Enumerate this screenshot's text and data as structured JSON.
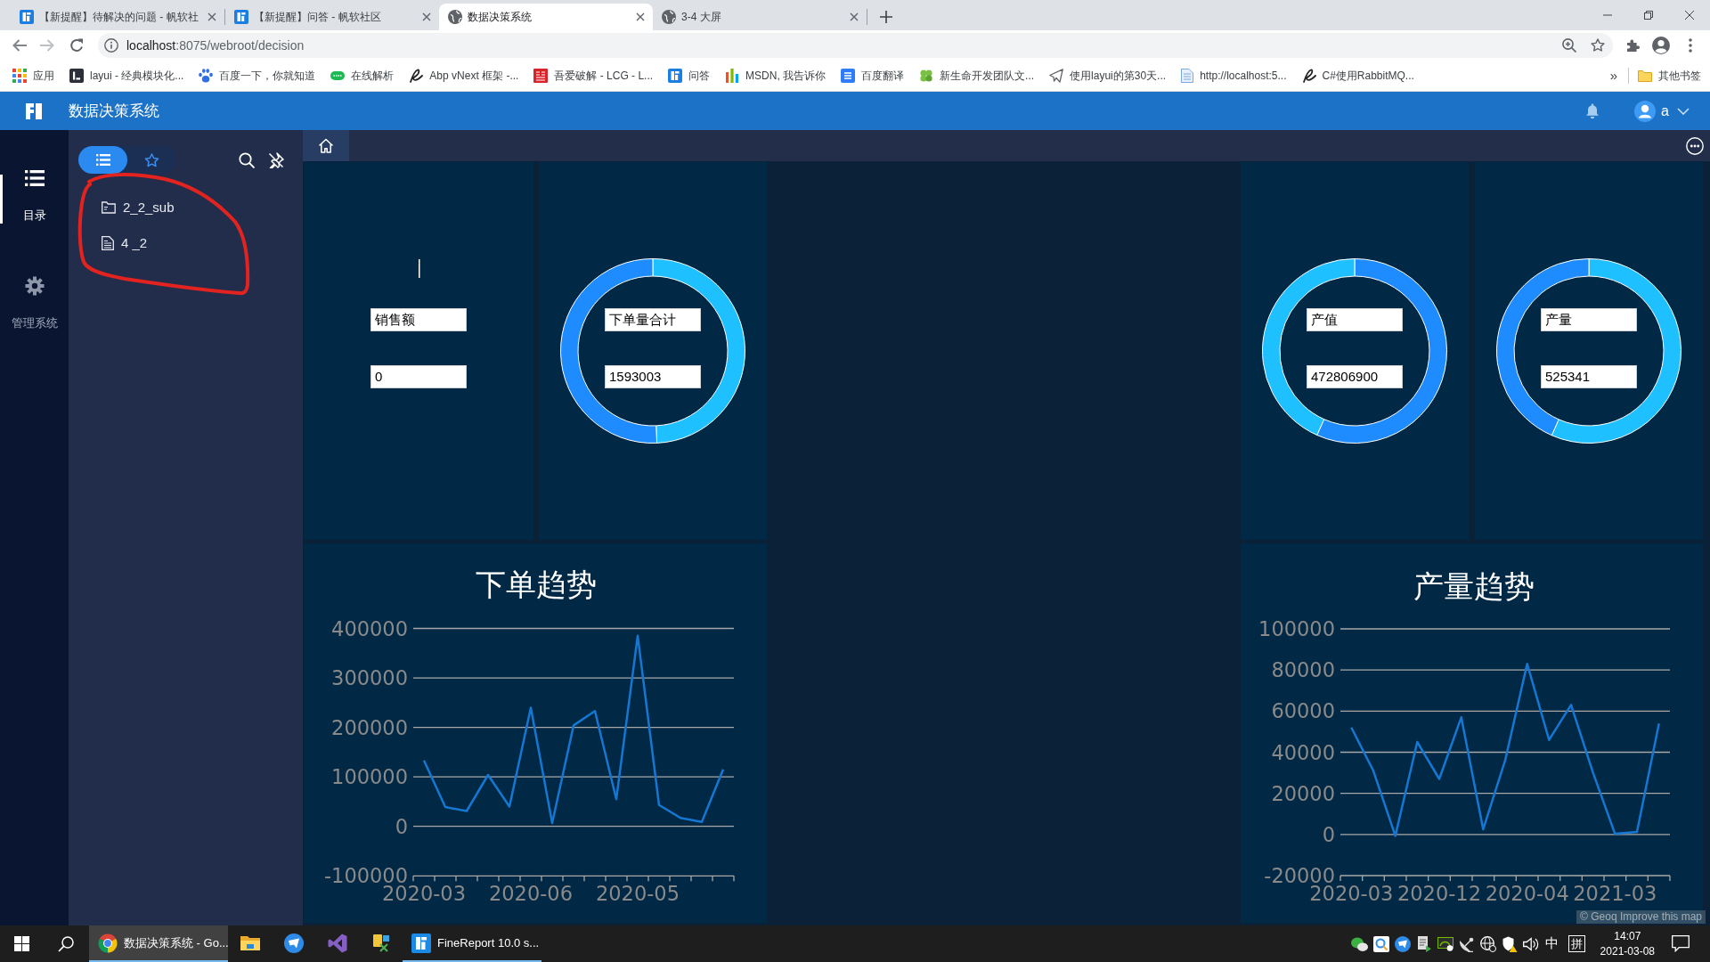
{
  "browser": {
    "tabs": [
      {
        "kind": "logo",
        "title": "【新提醒】待解决的问题 - 帆软社",
        "selected": false
      },
      {
        "kind": "logo",
        "title": "【新提醒】问答 - 帆软社区",
        "selected": false
      },
      {
        "kind": "globe",
        "title": "数据决策系统",
        "selected": true
      },
      {
        "kind": "globe",
        "title": "3-4 大屏",
        "selected": false
      }
    ],
    "address": {
      "host": "localhost",
      "path": ":8075/webroot/decision"
    },
    "bookmarks": [
      {
        "kind": "grid",
        "label": "应用"
      },
      {
        "kind": "dark-tile",
        "label": "layui - 经典模块化..."
      },
      {
        "kind": "paw",
        "label": "百度一下，你就知道"
      },
      {
        "kind": "badge",
        "label": "在线解析"
      },
      {
        "kind": "swirl",
        "label": "Abp vNext 框架 -..."
      },
      {
        "kind": "seal",
        "label": "吾爱破解 - LCG - L..."
      },
      {
        "kind": "logo",
        "label": "问答"
      },
      {
        "kind": "bars",
        "label": "MSDN, 我告诉你"
      },
      {
        "kind": "tile",
        "label": "百度翻译"
      },
      {
        "kind": "clover",
        "label": "新生命开发团队文..."
      },
      {
        "kind": "plane",
        "label": "使用layui的第30天..."
      },
      {
        "kind": "page",
        "label": "http://localhost:5..."
      },
      {
        "kind": "swirl",
        "label": "C#使用RabbitMQ..."
      }
    ],
    "overflow": "»",
    "other_bookmarks": "其他书签"
  },
  "header": {
    "title": "数据决策系统",
    "user": "a"
  },
  "nav": [
    {
      "kind": "list",
      "label": "目录",
      "selected": true
    },
    {
      "kind": "gear",
      "label": "管理系统",
      "selected": false
    }
  ],
  "directory": {
    "views": [
      {
        "kind": "list",
        "selected": true
      },
      {
        "kind": "star",
        "selected": false
      }
    ],
    "items": [
      {
        "kind": "folder",
        "label": "2_2_sub"
      },
      {
        "kind": "file",
        "label": "4 _2"
      }
    ]
  },
  "content_tabs": [
    {
      "kind": "home",
      "selected": true
    }
  ],
  "dashboard": {
    "panels": [
      {
        "kind": "plain",
        "fields": [
          {
            "value": "销售额"
          },
          {
            "value": "0"
          }
        ]
      },
      {
        "kind": "ring",
        "fields": [
          {
            "value": "下单量合计"
          },
          {
            "value": "1593003"
          }
        ]
      },
      {
        "kind": "ring",
        "fields": [
          {
            "value": "产值"
          },
          {
            "value": "472806900"
          }
        ]
      },
      {
        "kind": "ring",
        "fields": [
          {
            "value": "产量"
          },
          {
            "value": "525341"
          }
        ]
      }
    ],
    "charts": [
      {
        "chart_data": {
          "type": "line",
          "title": "下单趋势",
          "categories": [
            "2020-03",
            null,
            null,
            null,
            null,
            "2020-06",
            null,
            null,
            null,
            null,
            "2020-05",
            null,
            null,
            null,
            null
          ],
          "ylim": [
            -100000,
            400000
          ],
          "yticks": [
            -100000,
            0,
            100000,
            200000,
            300000,
            400000
          ],
          "grid": true,
          "values": [
            133000,
            39000,
            31000,
            104000,
            40000,
            240000,
            7000,
            204000,
            233000,
            55000,
            385000,
            43000,
            17000,
            9000,
            115000
          ]
        }
      },
      {
        "chart_data": {
          "type": "line",
          "title": "产量趋势",
          "categories": [
            "2020-03",
            null,
            null,
            null,
            "2020-12",
            null,
            null,
            null,
            "2020-04",
            null,
            null,
            null,
            "2021-03",
            null,
            null
          ],
          "ylim": [
            -20000,
            100000
          ],
          "yticks": [
            -20000,
            0,
            20000,
            40000,
            60000,
            80000,
            100000
          ],
          "grid": true,
          "values": [
            52000,
            31000,
            -700,
            45000,
            27000,
            57000,
            2500,
            36000,
            83000,
            46000,
            63000,
            30000,
            300,
            1200,
            54000
          ]
        }
      }
    ],
    "attribution": "© Geoq Improve this map"
  },
  "taskbar": {
    "apps": [
      {
        "kind": "browser",
        "label": "数据决策系统 - Go...",
        "selected": true,
        "running": true
      },
      {
        "kind": "folder",
        "selected": false,
        "running": false
      },
      {
        "kind": "feather",
        "selected": false,
        "running": false
      },
      {
        "kind": "ribbon",
        "selected": false,
        "running": false
      },
      {
        "kind": "tools",
        "selected": false,
        "running": false
      },
      {
        "kind": "logo",
        "label": "FineReport 10.0 s...",
        "selected": false,
        "running": true
      }
    ],
    "ime": "中",
    "ime_mode": "拼",
    "time": "14:07",
    "date": "2021-03-08"
  }
}
